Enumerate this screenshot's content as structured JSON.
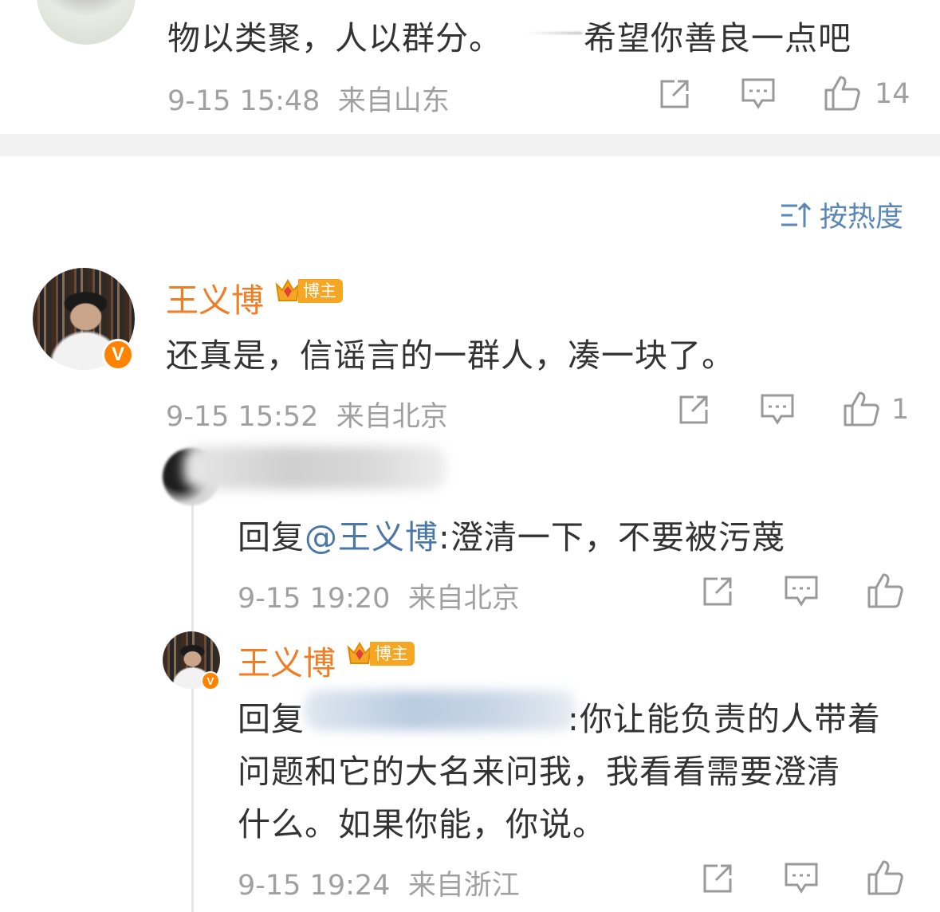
{
  "comment_top": {
    "text_left": "物以类聚，人以群分。",
    "text_right": "希望你善良一点吧",
    "time": "9-15 15:48",
    "location": "来自山东",
    "like_count": "14"
  },
  "sort": {
    "label": "按热度"
  },
  "comment_main": {
    "username": "王义博",
    "badge_label": "博主",
    "text": "还真是，信谣言的一群人，凑一块了。",
    "time": "9-15 15:52",
    "location": "来自北京",
    "like_count": "1"
  },
  "reply_1": {
    "prefix": "回复",
    "mention": "@王义博",
    "text": ":澄清一下，不要被污蔑",
    "time": "9-15 19:20",
    "location": "来自北京"
  },
  "reply_2": {
    "username": "王义博",
    "badge_label": "博主",
    "prefix": "回复",
    "line1": ":你让能负责的人带着",
    "line2": "问题和它的大名来问我，我看看需要澄清",
    "line3": "什么。如果你能，你说。",
    "time": "9-15 19:24",
    "location": "来自浙江"
  },
  "colors": {
    "username": "#f07c24",
    "mention": "#4a77a8",
    "meta": "#a0a0a0",
    "verified": "#ff8200",
    "badge": "#f5a623",
    "separator": "#f2f2f2"
  },
  "icons": [
    "share-icon",
    "comment-icon",
    "like-icon",
    "sort-icon",
    "crown-icon",
    "verified-icon"
  ]
}
